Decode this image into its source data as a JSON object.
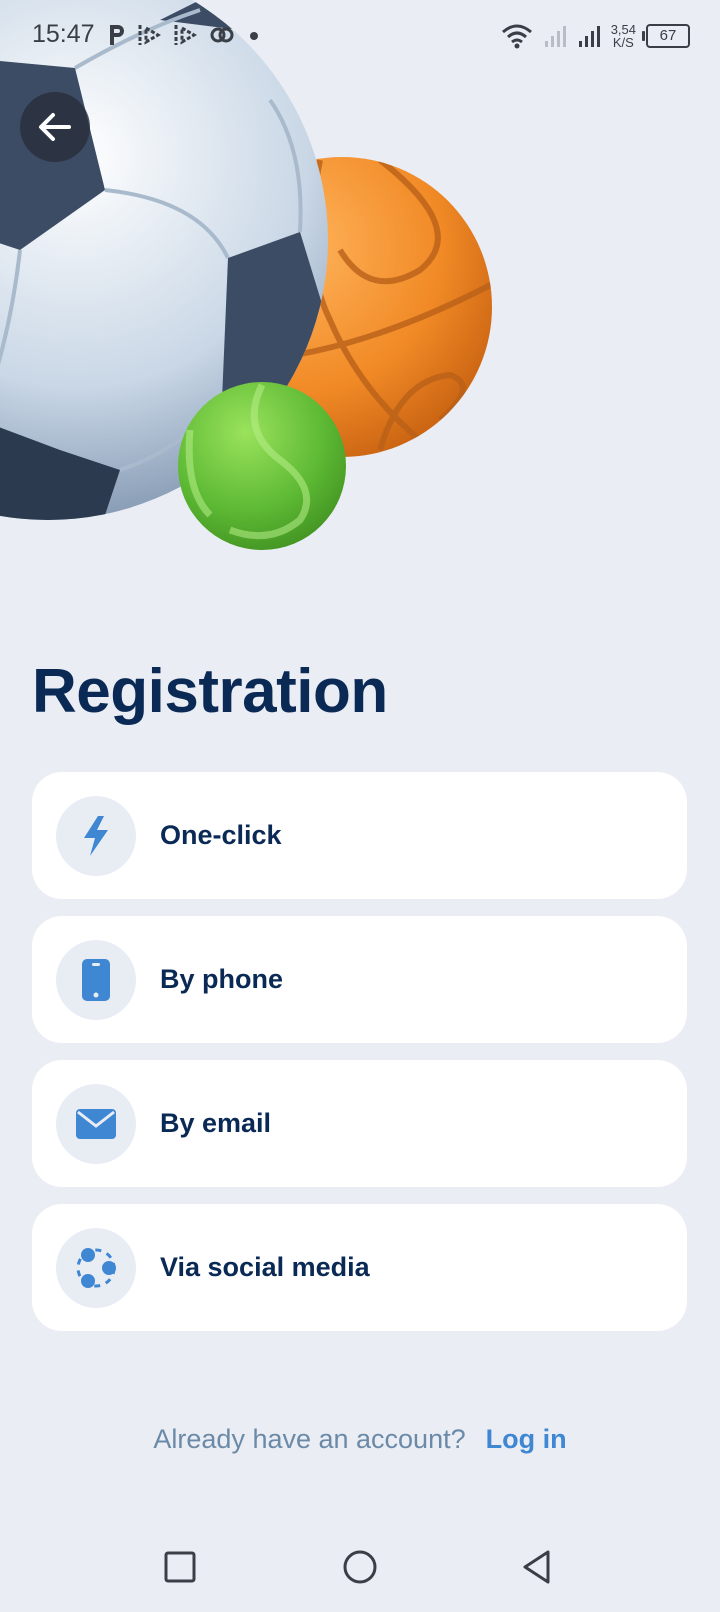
{
  "status_bar": {
    "time": "15:47",
    "net_speed_value": "3,54",
    "net_speed_unit": "K/S",
    "battery": "67"
  },
  "page": {
    "title": "Registration"
  },
  "options": [
    {
      "label": "One-click",
      "icon": "lightning-icon"
    },
    {
      "label": "By phone",
      "icon": "phone-icon"
    },
    {
      "label": "By email",
      "icon": "envelope-icon"
    },
    {
      "label": "Via social media",
      "icon": "social-media-icon"
    }
  ],
  "footer": {
    "prompt": "Already have an account?",
    "login_label": "Log in"
  },
  "colors": {
    "background": "#eaedf3",
    "title": "#0a2a55",
    "accent": "#3f86d3",
    "card": "#ffffff"
  }
}
